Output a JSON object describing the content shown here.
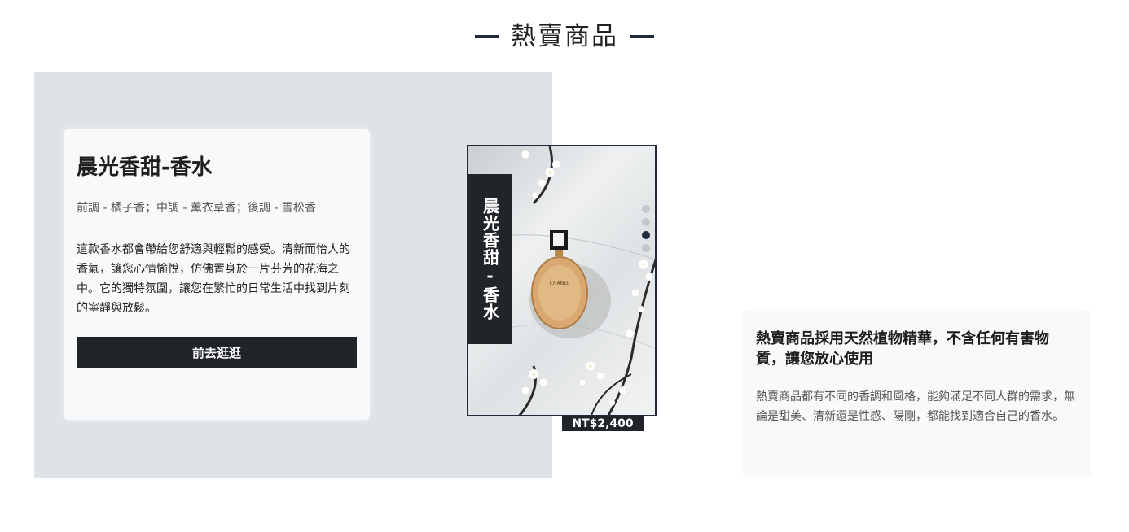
{
  "section": {
    "title": "熱賣商品"
  },
  "product": {
    "name": "晨光香甜-香水",
    "notes": "前調 - 橘子香；中調 - 薰衣草香；後調 - 雪松香",
    "description": "這款香水都會帶給您舒適與輕鬆的感受。清新而怡人的香氣，讓您心情愉悅，仿佛置身於一片芬芳的花海之中。它的獨特氛圍，讓您在繁忙的日常生活中找到片刻的寧靜與放鬆。",
    "button_label": "前去逛逛",
    "vertical_title": "晨光香甜-香水",
    "price": "NT$2,400",
    "bottle_brand": "CHANEL"
  },
  "carousel": {
    "dots": 4,
    "active_index": 2
  },
  "info": {
    "heading": "熱賣商品採用天然植物精華，不含任何有害物質，讓您放心使用",
    "body": "熱賣商品都有不同的香調和風格，能夠滿足不同人群的需求，無論是甜美、清新還是性感、陽剛，都能找到適合自己的香水。"
  },
  "colors": {
    "dark": "#212529",
    "panel": "#dee3e5",
    "card": "#f7f9fa"
  }
}
